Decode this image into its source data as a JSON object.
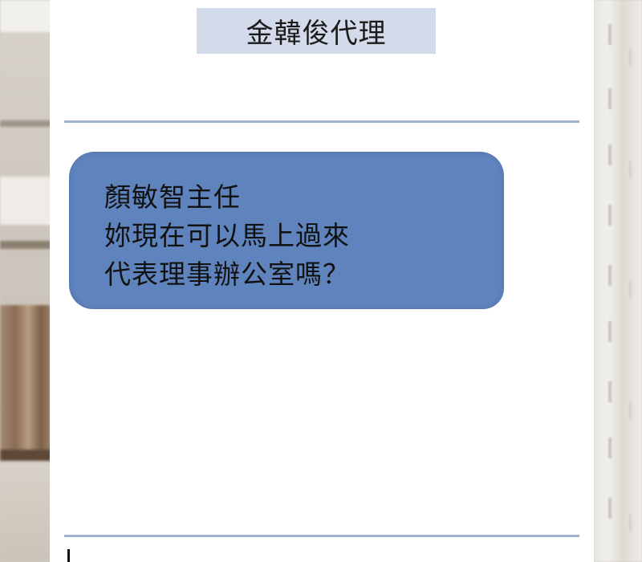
{
  "chat": {
    "contact_name": "金韓俊代理",
    "message": {
      "line1": "顏敏智主任",
      "line2": "妳現在可以馬上過來",
      "line3": "代表理事辦公室嗎？"
    }
  },
  "colors": {
    "header_bg": "#d3dbea",
    "bubble_bg": "#5f83bd",
    "divider": "#9fb2cf",
    "panel_bg": "#ffffff"
  }
}
